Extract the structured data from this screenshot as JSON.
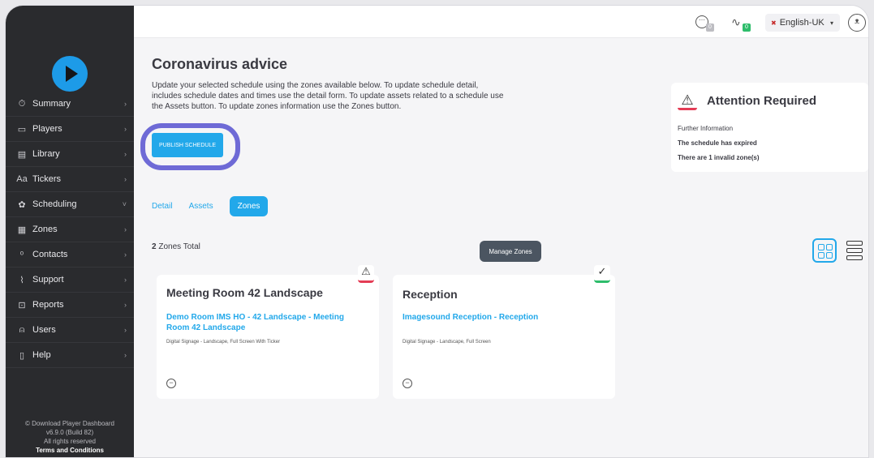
{
  "sidebar": {
    "items": [
      {
        "icon": "clock-icon",
        "glyph": "⏱",
        "label": "Summary",
        "chevron": "›"
      },
      {
        "icon": "player-icon",
        "glyph": "▭",
        "label": "Players",
        "chevron": "›"
      },
      {
        "icon": "library-icon",
        "glyph": "▤",
        "label": "Library",
        "chevron": "›"
      },
      {
        "icon": "tickers-icon",
        "glyph": "Aa",
        "label": "Tickers",
        "chevron": "›"
      },
      {
        "icon": "scheduling-icon",
        "glyph": "✿",
        "label": "Scheduling",
        "chevron": "˅"
      },
      {
        "icon": "zones-icon",
        "glyph": "▦",
        "label": "Zones",
        "chevron": "›"
      },
      {
        "icon": "contacts-icon",
        "glyph": "ᵒ",
        "label": "Contacts",
        "chevron": "›"
      },
      {
        "icon": "support-icon",
        "glyph": "⌇",
        "label": "Support",
        "chevron": "›"
      },
      {
        "icon": "reports-icon",
        "glyph": "⊡",
        "label": "Reports",
        "chevron": "›"
      },
      {
        "icon": "users-icon",
        "glyph": "⍝",
        "label": "Users",
        "chevron": "›"
      },
      {
        "icon": "help-icon",
        "glyph": "▯",
        "label": "Help",
        "chevron": "›"
      }
    ],
    "footer": {
      "copyright": "© Download Player Dashboard",
      "version": "v6.9.0 (Build 82)",
      "rights": "All rights reserved",
      "terms": "Terms and Conditions"
    }
  },
  "topbar": {
    "chat_badge": "0",
    "activity_badge": "0",
    "language": "English-UK",
    "language_caret": "▾"
  },
  "header": {
    "title": "Coronavirus advice",
    "description": "Update your selected schedule using the zones available below. To update schedule detail, includes schedule dates and times use the detail form. To update assets related to a schedule use the Assets button. To update zones information use the Zones button.",
    "publish_button": "PUBLISH SCHEDULE"
  },
  "attention": {
    "title": "Attention Required",
    "line1": "Further Information",
    "line2": "The schedule has expired",
    "line3": "There are 1 invalid zone(s)"
  },
  "tabs": [
    {
      "label": "Detail"
    },
    {
      "label": "Assets"
    },
    {
      "label": "Zones"
    }
  ],
  "zones": {
    "total_count": "2",
    "total_label": " Zones Total",
    "manage_button": "Manage Zones",
    "cards": [
      {
        "title": "Meeting Room 42 Landscape",
        "link": "Demo Room IMS HO - 42 Landscape - Meeting Room 42 Landscape",
        "meta": "Digital Signage - Landscape, Full Screen With Ticker",
        "status": "warning"
      },
      {
        "title": "Reception",
        "link": "Imagesound Reception - Reception",
        "meta": "Digital Signage - Landscape, Full Screen",
        "status": "ok"
      }
    ]
  },
  "colors": {
    "accent": "#22a8ea",
    "sidebar_bg": "#2a2b2e",
    "warning": "#e43c55",
    "ok": "#2ebd6b",
    "highlight_ring": "#6e6ad6"
  }
}
